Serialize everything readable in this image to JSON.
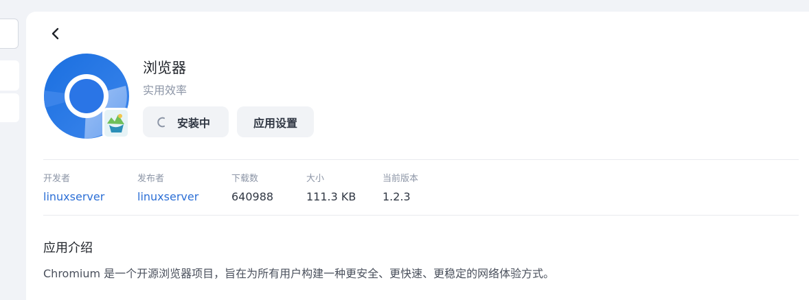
{
  "app": {
    "name": "浏览器",
    "category": "实用效率",
    "install_button": "安装中",
    "settings_button": "应用设置"
  },
  "meta": [
    {
      "label": "开发者",
      "value": "linuxserver",
      "link": true
    },
    {
      "label": "发布者",
      "value": "linuxserver",
      "link": true
    },
    {
      "label": "下载数",
      "value": "640988",
      "link": false
    },
    {
      "label": "大小",
      "value": "111.3 KB",
      "link": false
    },
    {
      "label": "当前版本",
      "value": "1.2.3",
      "link": false
    }
  ],
  "intro": {
    "title": "应用介绍",
    "line1": "Chromium 是一个开源浏览器项目，旨在为所有用户构建一种更安全、更快速、更稳定的网络体验方式。"
  },
  "colors": {
    "link": "#2c6fd6",
    "button_bg": "#f1f3f6",
    "page_bg": "#f1f3f7"
  },
  "icons": {
    "back": "chevron-left-icon",
    "app": "chromium-logo-icon",
    "spinner": "loading-spinner-icon"
  }
}
